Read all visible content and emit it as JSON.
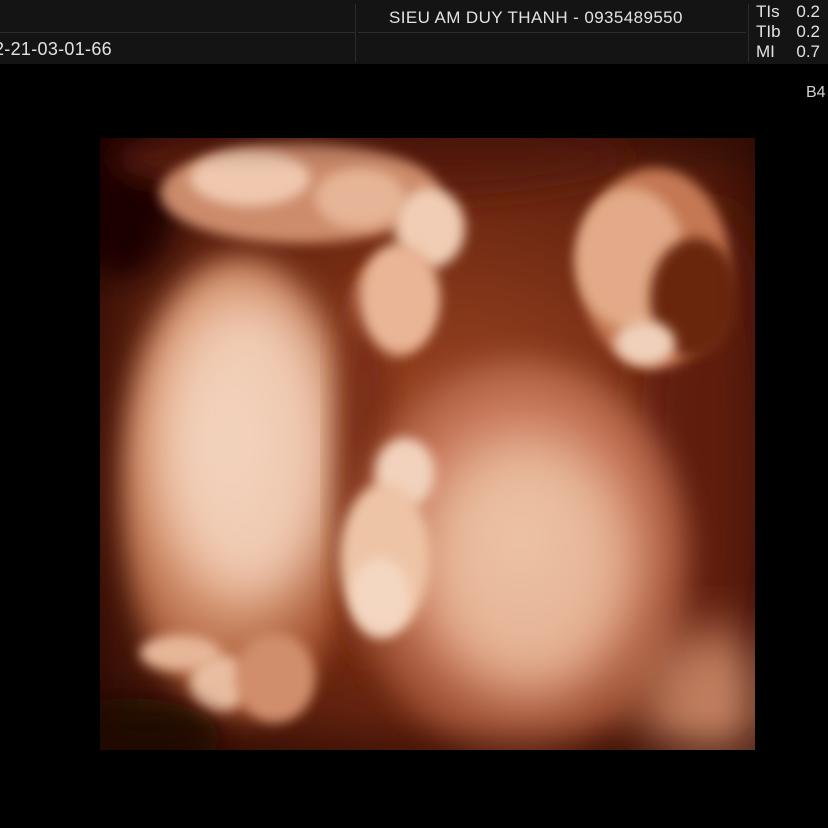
{
  "header": {
    "exam_id": "2-21-03-01-66",
    "clinic": "SIEU AM DUY THANH - 0935489550"
  },
  "indices": [
    {
      "label": "TIs",
      "value": "0.2"
    },
    {
      "label": "TIb",
      "value": "0.2"
    },
    {
      "label": "MI",
      "value": "0.7"
    }
  ],
  "probe_label": "B4",
  "image": {
    "subject": "3D rendered fetal ultrasound",
    "palette": {
      "shadow": "#2a0a03",
      "deep": "#6b2610",
      "mid": "#b05a34",
      "light": "#e8b89a",
      "highlight": "#f6dcc8"
    }
  }
}
